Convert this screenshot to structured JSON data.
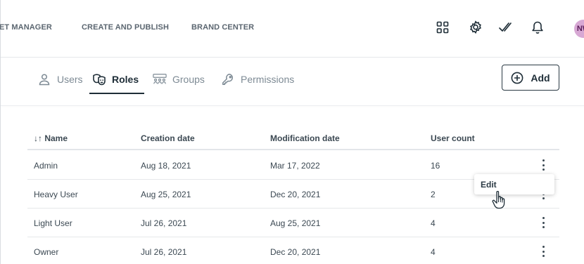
{
  "topnav": {
    "links": [
      "ET MANAGER",
      "CREATE AND PUBLISH",
      "BRAND CENTER"
    ],
    "icons": [
      "apps-grid-icon",
      "gear-icon",
      "double-check-icon",
      "bell-icon"
    ],
    "avatar_initials": "NW"
  },
  "tabs": [
    {
      "label": "Users",
      "icon": "user-icon",
      "active": false
    },
    {
      "label": "Roles",
      "icon": "masks-icon",
      "active": true
    },
    {
      "label": "Groups",
      "icon": "groups-icon",
      "active": false
    },
    {
      "label": "Permissions",
      "icon": "key-icon",
      "active": false
    }
  ],
  "add_button": {
    "label": "Add",
    "icon": "plus-circle-icon"
  },
  "table": {
    "columns": [
      "↓↑ Name",
      "Creation date",
      "Modification date",
      "User count"
    ],
    "rows": [
      {
        "name": "Admin",
        "created": "Aug 18, 2021",
        "modified": "Mar 17, 2022",
        "users": "16"
      },
      {
        "name": "Heavy User",
        "created": "Aug 25, 2021",
        "modified": "Dec 20, 2021",
        "users": "2"
      },
      {
        "name": "Light User",
        "created": "Jul 26, 2021",
        "modified": "Aug 25, 2021",
        "users": "4"
      },
      {
        "name": "Owner",
        "created": "Jul 26, 2021",
        "modified": "Dec 20, 2021",
        "users": "4"
      }
    ]
  },
  "context_menu": {
    "items": [
      "Edit"
    ]
  },
  "colors": {
    "avatar_bg": "#d7a8d4",
    "avatar_text": "#5a1d59",
    "text": "#2b3a44",
    "muted": "#7d8a94"
  }
}
